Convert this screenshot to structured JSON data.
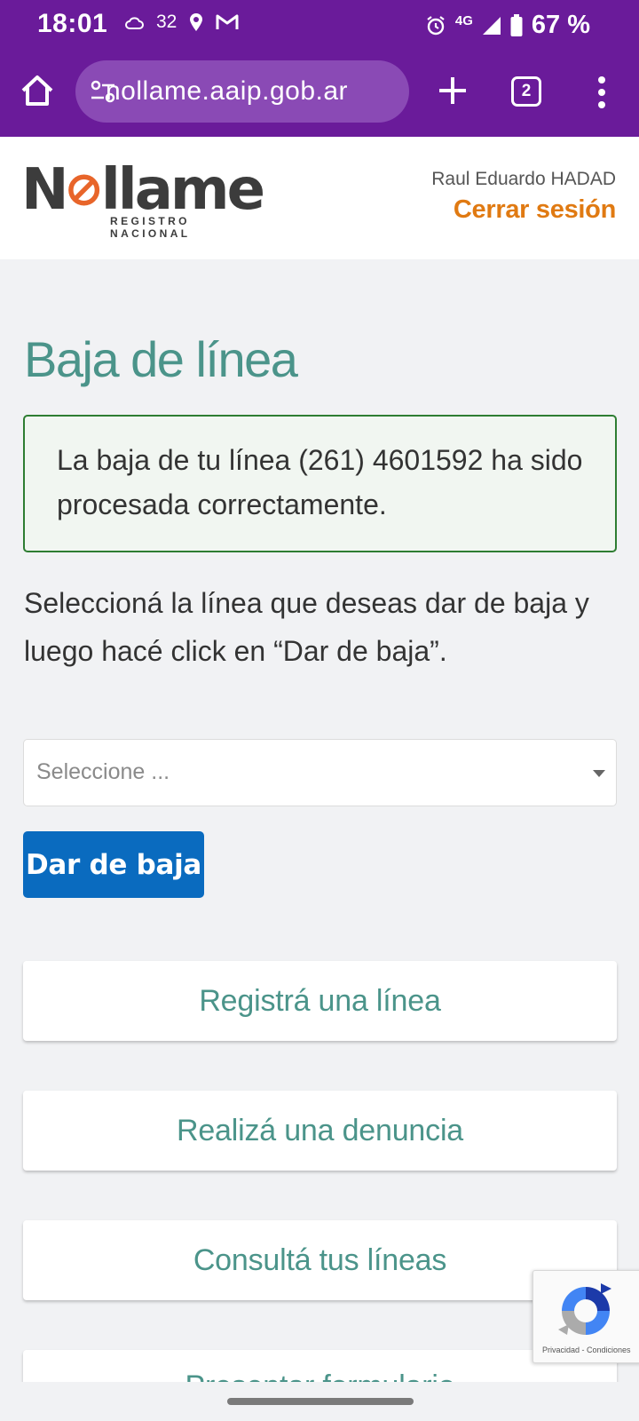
{
  "status_bar": {
    "time": "18:01",
    "temperature": "32",
    "network": "4G",
    "battery": "67 %"
  },
  "browser": {
    "url": "nollame.aaip.gob.ar",
    "tab_count": "2"
  },
  "header": {
    "logo_text": "N llame",
    "logo_subtitle": "REGISTRO NACIONAL",
    "user_name": "Raul Eduardo HADAD",
    "logout_label": "Cerrar sesión"
  },
  "main": {
    "title": "Baja de línea",
    "alert_message": "La baja de tu línea (261) 4601592 ha sido procesada correctamente.",
    "instructions": "Seleccioná la línea que deseas dar de baja y luego hacé click en “Dar de baja”.",
    "select_placeholder": "Seleccione ...",
    "submit_label": "Dar de baja"
  },
  "nav_cards": [
    {
      "label": "Registrá una línea"
    },
    {
      "label": "Realizá una denuncia"
    },
    {
      "label": "Consultá tus líneas"
    },
    {
      "label": "Presentar formulario"
    }
  ],
  "recaptcha": {
    "links": "Privacidad - Condiciones"
  },
  "colors": {
    "status_bar": "#6a1b9a",
    "title_teal": "#4b948a",
    "accent_orange": "#e07a12",
    "primary_button": "#0a6bbf",
    "alert_border": "#2e7d32"
  }
}
